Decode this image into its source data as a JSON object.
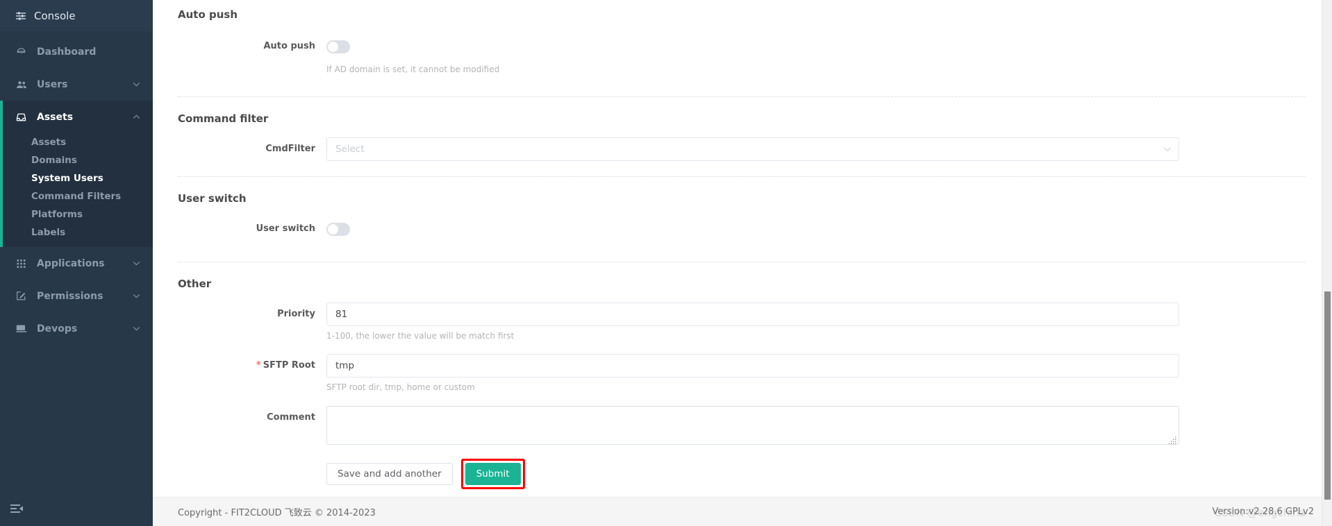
{
  "sidebar": {
    "brand": "Console",
    "brand_icon": "sliders-icon",
    "items": [
      {
        "label": "Dashboard",
        "icon": "dashboard-icon",
        "expandable": false
      },
      {
        "label": "Users",
        "icon": "users-icon",
        "expandable": true
      },
      {
        "label": "Assets",
        "icon": "inbox-icon",
        "expandable": true,
        "expanded": true,
        "children": [
          {
            "label": "Assets",
            "active": false
          },
          {
            "label": "Domains",
            "active": false
          },
          {
            "label": "System Users",
            "active": true
          },
          {
            "label": "Command Filters",
            "active": false
          },
          {
            "label": "Platforms",
            "active": false
          },
          {
            "label": "Labels",
            "active": false
          }
        ]
      },
      {
        "label": "Applications",
        "icon": "grid-icon",
        "expandable": true
      },
      {
        "label": "Permissions",
        "icon": "edit-square-icon",
        "expandable": true
      },
      {
        "label": "Devops",
        "icon": "terminal-icon",
        "expandable": true
      }
    ],
    "collapse_icon": "sidebar-collapse-icon"
  },
  "form": {
    "sections": [
      {
        "title": "Auto push",
        "fields": [
          {
            "label": "Auto push",
            "type": "switch",
            "value": "off",
            "help": "If AD domain is set, it cannot be modified"
          }
        ]
      },
      {
        "title": "Command filter",
        "fields": [
          {
            "label": "CmdFilter",
            "type": "select",
            "value": "",
            "placeholder": "Select",
            "help": ""
          }
        ]
      },
      {
        "title": "User switch",
        "fields": [
          {
            "label": "User switch",
            "type": "switch",
            "value": "off",
            "help": ""
          }
        ]
      },
      {
        "title": "Other",
        "fields": [
          {
            "label": "Priority",
            "type": "text",
            "value": "81",
            "placeholder": "",
            "help": "1-100, the lower the value will be match first",
            "required": false
          },
          {
            "label": "SFTP Root",
            "type": "text",
            "value": "tmp",
            "placeholder": "",
            "help": "SFTP root dir, tmp, home or custom",
            "required": true
          },
          {
            "label": "Comment",
            "type": "textarea",
            "value": "",
            "placeholder": "",
            "help": ""
          }
        ]
      }
    ],
    "buttons": {
      "save_and_add": "Save and add another",
      "submit": "Submit"
    }
  },
  "footer": {
    "copyright": "Copyright - FIT2CLOUD 飞致云 © 2014-2023",
    "version": "Version:v2.28.6 GPLv2"
  },
  "watermark": "CSDN @engchina",
  "colors": {
    "sidebar_bg": "#273849",
    "sidebar_active_bg": "#22303f",
    "accent": "#1ab394",
    "highlight": "#ff0000",
    "required": "#f56c6c"
  }
}
